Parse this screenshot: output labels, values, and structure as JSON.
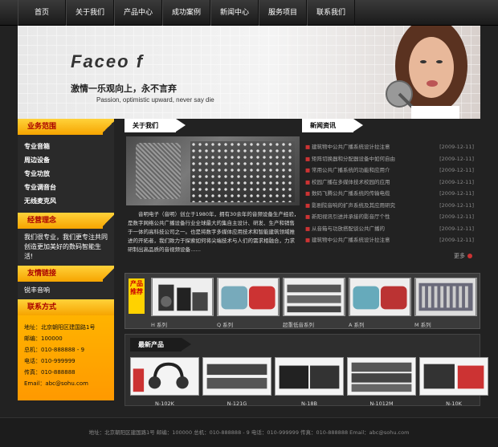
{
  "nav": [
    "首页",
    "关于我们",
    "产品中心",
    "成功案例",
    "新闻中心",
    "服务项目",
    "联系我们"
  ],
  "banner": {
    "logo": "Faceo f",
    "slogan_cn": "激情一乐观向上，永不言弃",
    "slogan_en": "Passion, optimistic upward, never say die"
  },
  "sidebar": {
    "business_head": "业务范围",
    "business_items": [
      "专业音箱",
      "周边设备",
      "专业功放",
      "专业调音台",
      "无线麦克风"
    ],
    "idea_head": "经营理念",
    "idea_text": "我们很专业，我们更专注共同创造更加美好的数码智能生活!",
    "links_head": "友情链接",
    "links_item": "锐丰音响",
    "contact_head": "联系方式",
    "contact_lines": [
      "地址：北京朝阳区建国路1号",
      "邮编：100000",
      "总机：010-888888 - 9",
      "电话：010-999999",
      "传真：010-888888",
      "Email：abc@sohu.com"
    ]
  },
  "about": {
    "head": "关于我们",
    "text": "音明电子（音明）创立于1980年，拥有30余年的音频设备生产经验，是数字网络公共广播设备行业全球最大的集自主设计、研发、生产和销售于一体的高科技公司之一。也是将数字多媒体应用技术和智能建筑领域推进的开拓者，我们致力于探索如何将尖端技术与人们的需求相融合，力求研制出高品质的音视频设备……"
  },
  "news": {
    "head": "新闻资讯",
    "items": [
      {
        "title": "建筑物中公共广播系统设计拉注意",
        "date": "[2009-12-11]"
      },
      {
        "title": "矩阵切换器和分配器设备中如何自由",
        "date": "[2009-12-11]"
      },
      {
        "title": "常用公共广播系统的功能和应用介",
        "date": "[2009-12-11]"
      },
      {
        "title": "校园广播在多媒体技术校园的应用",
        "date": "[2009-12-11]"
      },
      {
        "title": "数码飞腾公共广播系统的传输电缆",
        "date": "[2009-12-11]"
      },
      {
        "title": "影剧院音响的扩声系统及其应用研究",
        "date": "[2009-12-11]"
      },
      {
        "title": "新阳视讯引进并承接的影音厅个性",
        "date": "[2009-12-11]"
      },
      {
        "title": "从音箱与功放搭配谈公共广播的",
        "date": "[2009-12-11]"
      },
      {
        "title": "建筑物中公共广播系统设计拉注意",
        "date": "[2009-12-11]"
      }
    ],
    "more": "更多"
  },
  "recommend": {
    "tag": "产品推荐",
    "items": [
      {
        "cap": "H 系列",
        "color": "#6a7"
      },
      {
        "cap": "Q 系列",
        "color": "#7ab"
      },
      {
        "cap": "超重低音系列",
        "color": "#889"
      },
      {
        "cap": "A 系列",
        "color": "#6ab"
      },
      {
        "cap": "M 系列",
        "color": "#6a6a7a"
      }
    ]
  },
  "newproducts": {
    "head": "最新产品",
    "items": [
      {
        "cap": "N-102K"
      },
      {
        "cap": "N-121G"
      },
      {
        "cap": "N-18B"
      },
      {
        "cap": "N-1012M"
      },
      {
        "cap": "N-10K"
      }
    ]
  },
  "footer": "地址：北京朝阳区建国路1号 邮编：100000 总机：010-888888 - 9 电话：010-999999 传真：010-888888 Email：abc@sohu.com"
}
